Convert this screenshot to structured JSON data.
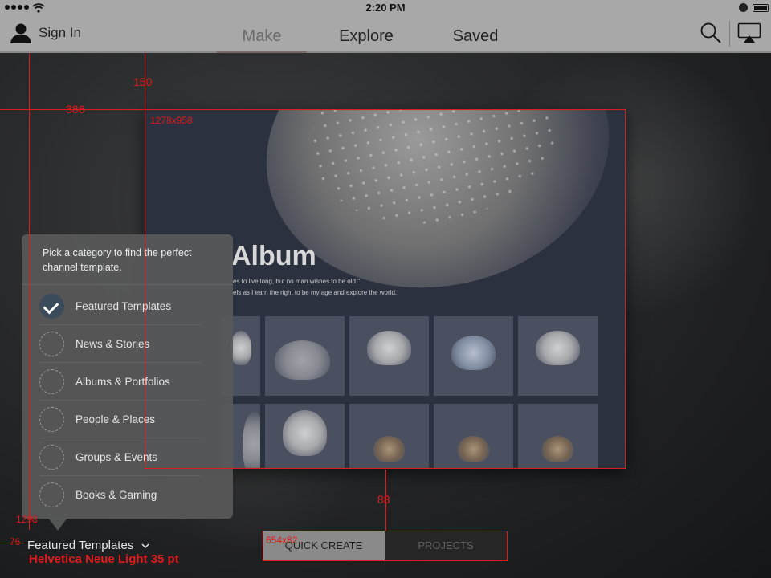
{
  "status_bar": {
    "time": "2:20 PM",
    "signal_icon": "signal-dots-icon",
    "wifi_icon": "wifi-icon",
    "lock_icon": "orientation-lock-icon",
    "battery_icon": "battery-icon"
  },
  "nav": {
    "sign_in": "Sign In",
    "avatar_icon": "user-icon",
    "tabs": [
      {
        "label": "Make",
        "active": true
      },
      {
        "label": "Explore",
        "active": false
      },
      {
        "label": "Saved",
        "active": false
      }
    ],
    "search_icon": "search-icon",
    "airplay_icon": "airplay-icon"
  },
  "preview": {
    "title": "Album",
    "lines": [
      "es to live long, but no man wishes to be old.\"",
      "els as I earn the right to be my age and explore the world."
    ],
    "thumbnail_count": 10
  },
  "popover": {
    "intro": "Pick a category to find the perfect channel template.",
    "categories": [
      {
        "label": "Featured Templates",
        "selected": true
      },
      {
        "label": "News & Stories",
        "selected": false
      },
      {
        "label": "Albums & Portfolios",
        "selected": false
      },
      {
        "label": "People & Places",
        "selected": false
      },
      {
        "label": "Groups & Events",
        "selected": false
      },
      {
        "label": "Books & Gaming",
        "selected": false
      }
    ]
  },
  "bottom": {
    "category_selector": "Featured Templates",
    "chevron_icon": "chevron-down-icon",
    "segments": [
      {
        "label": "QUICK CREATE",
        "active": true
      },
      {
        "label": "PROJECTS",
        "active": false
      }
    ]
  },
  "annotations": {
    "color": "#e01b1b",
    "preview_size": "1278x958",
    "segment_size": "654x82",
    "top_offset": "150",
    "left_offset": "386",
    "gap_below_preview": "88",
    "popover_bottom": "1298",
    "left_margin": "76",
    "font_note": "Helvetica Neue Light 35 pt"
  }
}
